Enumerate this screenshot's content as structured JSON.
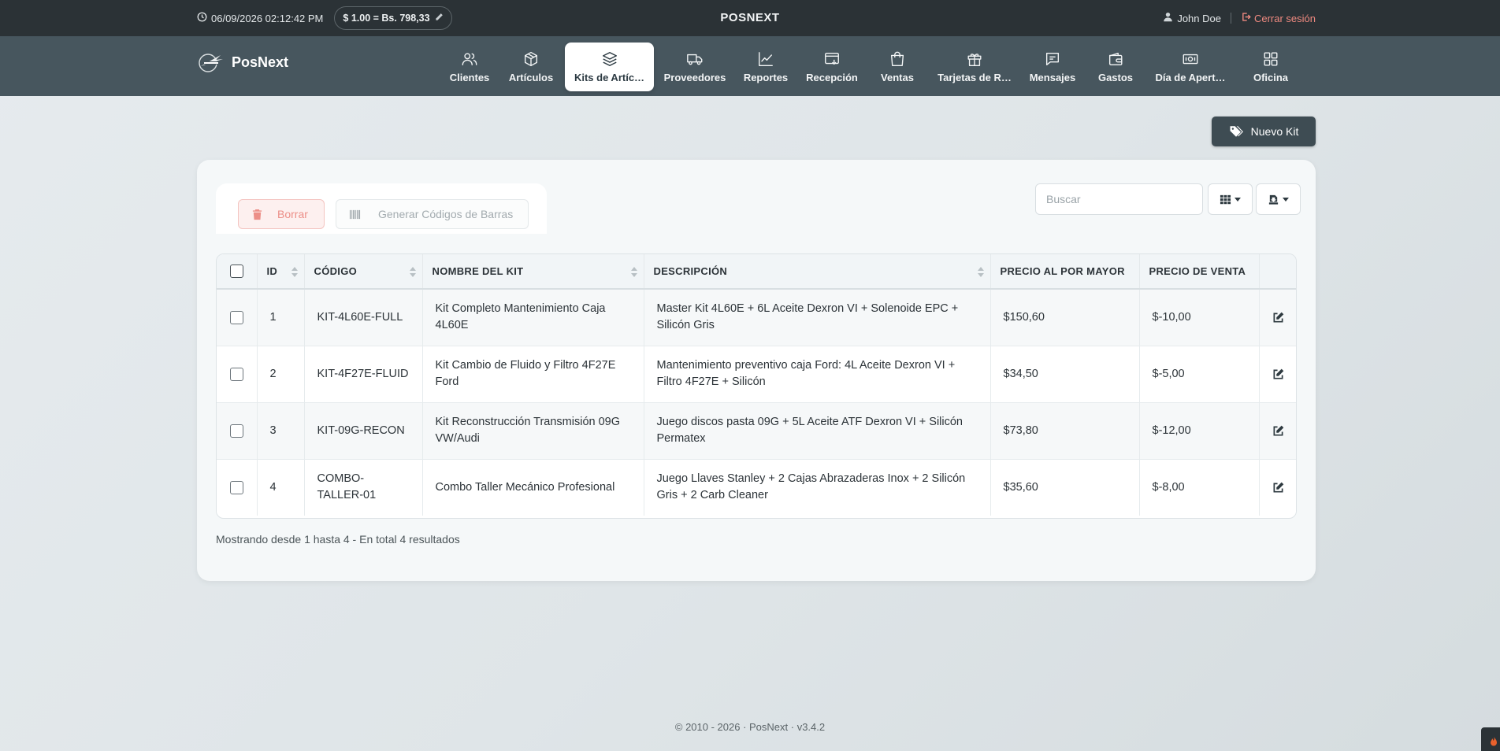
{
  "topbar": {
    "datetime": "06/09/2026 02:12:42 PM",
    "rate": "$ 1.00 = Bs. 798,33",
    "brand": "POSNEXT",
    "user": "John Doe",
    "logout": "Cerrar sesión"
  },
  "navbar": {
    "logo_text": "PosNext",
    "items": [
      {
        "label": "Clientes",
        "icon": "users-icon"
      },
      {
        "label": "Artículos",
        "icon": "box-icon"
      },
      {
        "label": "Kits de Artíc…",
        "icon": "layers-icon",
        "active": true
      },
      {
        "label": "Proveedores",
        "icon": "truck-icon"
      },
      {
        "label": "Reportes",
        "icon": "chart-line-icon"
      },
      {
        "label": "Recepción",
        "icon": "receiving-icon"
      },
      {
        "label": "Ventas",
        "icon": "shopping-bag-icon"
      },
      {
        "label": "Tarjetas de R…",
        "icon": "gift-icon"
      },
      {
        "label": "Mensajes",
        "icon": "message-icon"
      },
      {
        "label": "Gastos",
        "icon": "wallet-icon"
      },
      {
        "label": "Día de Apert…",
        "icon": "cash-icon"
      },
      {
        "label": "Oficina",
        "icon": "grid-icon"
      }
    ]
  },
  "actions": {
    "new_kit": "Nuevo Kit"
  },
  "toolbar": {
    "delete": "Borrar",
    "barcodes": "Generar Códigos de Barras",
    "search_placeholder": "Buscar"
  },
  "table": {
    "headers": [
      "ID",
      "CÓDIGO",
      "NOMBRE DEL KIT",
      "DESCRIPCIÓN",
      "PRECIO AL POR MAYOR",
      "PRECIO DE VENTA"
    ],
    "rows": [
      {
        "id": "1",
        "code": "KIT-4L60E-FULL",
        "name": "Kit Completo Mantenimiento Caja 4L60E",
        "description": "Master Kit 4L60E + 6L Aceite Dexron VI + Solenoide EPC + Silicón Gris",
        "wholesale": "$150,60",
        "retail": "$-10,00"
      },
      {
        "id": "2",
        "code": "KIT-4F27E-FLUID",
        "name": "Kit Cambio de Fluido y Filtro 4F27E Ford",
        "description": "Mantenimiento preventivo caja Ford: 4L Aceite Dexron VI + Filtro 4F27E + Silicón",
        "wholesale": "$34,50",
        "retail": "$-5,00"
      },
      {
        "id": "3",
        "code": "KIT-09G-RECON",
        "name": "Kit Reconstrucción Transmisión 09G VW/Audi",
        "description": "Juego discos pasta 09G + 5L Aceite ATF Dexron VI + Silicón Permatex",
        "wholesale": "$73,80",
        "retail": "$-12,00"
      },
      {
        "id": "4",
        "code": "COMBO-TALLER-01",
        "name": "Combo Taller Mecánico Profesional",
        "description": "Juego Llaves Stanley + 2 Cajas Abrazaderas Inox + 2 Silicón Gris + 2 Carb Cleaner",
        "wholesale": "$35,60",
        "retail": "$-8,00"
      }
    ]
  },
  "summary": "Mostrando desde 1 hasta 4 - En total 4 resultados",
  "footer": "© 2010 - 2026 · PosNext · v3.4.2",
  "colors": {
    "topbar": "#2b3236",
    "navbar": "#47565e",
    "logout": "#f08a80",
    "danger_light": "#fdf0ef"
  }
}
